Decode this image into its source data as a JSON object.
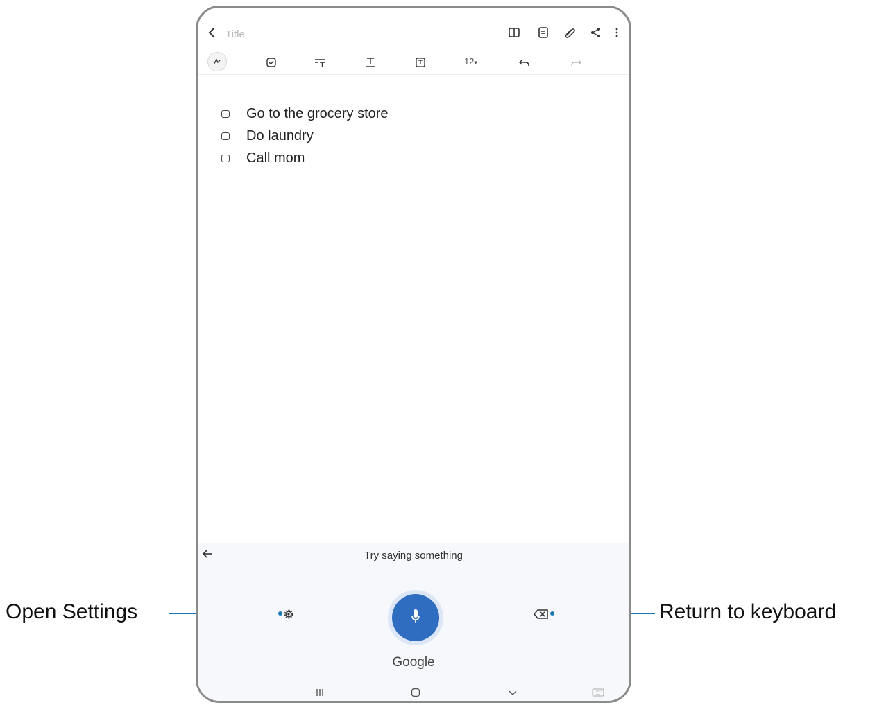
{
  "note": {
    "title_placeholder": "Title",
    "font_size": "12",
    "checklist": [
      "Go to the grocery store",
      "Do laundry",
      "Call mom"
    ]
  },
  "voice_input": {
    "prompt": "Try saying something",
    "brand": "Google"
  },
  "callouts": {
    "open_settings": "Open Settings",
    "return_to_keyboard": "Return to keyboard"
  },
  "icons": {
    "topbar": [
      "back-icon",
      "book-view-icon",
      "document-icon",
      "attach-icon",
      "share-icon",
      "more-icon"
    ],
    "toolbar": [
      "pen-icon",
      "checkbox-icon",
      "text-style-icon",
      "text-format-icon",
      "text-box-icon",
      "undo-icon",
      "redo-icon"
    ],
    "voice": [
      "back-arrow-icon",
      "gear-icon",
      "microphone-icon",
      "backspace-icon"
    ],
    "navbar": [
      "recents-icon",
      "home-icon",
      "hide-keyboard-icon",
      "keyboard-icon"
    ]
  },
  "colors": {
    "mic_button": "#2f6dc0",
    "callout_line": "#1a7ab8"
  }
}
